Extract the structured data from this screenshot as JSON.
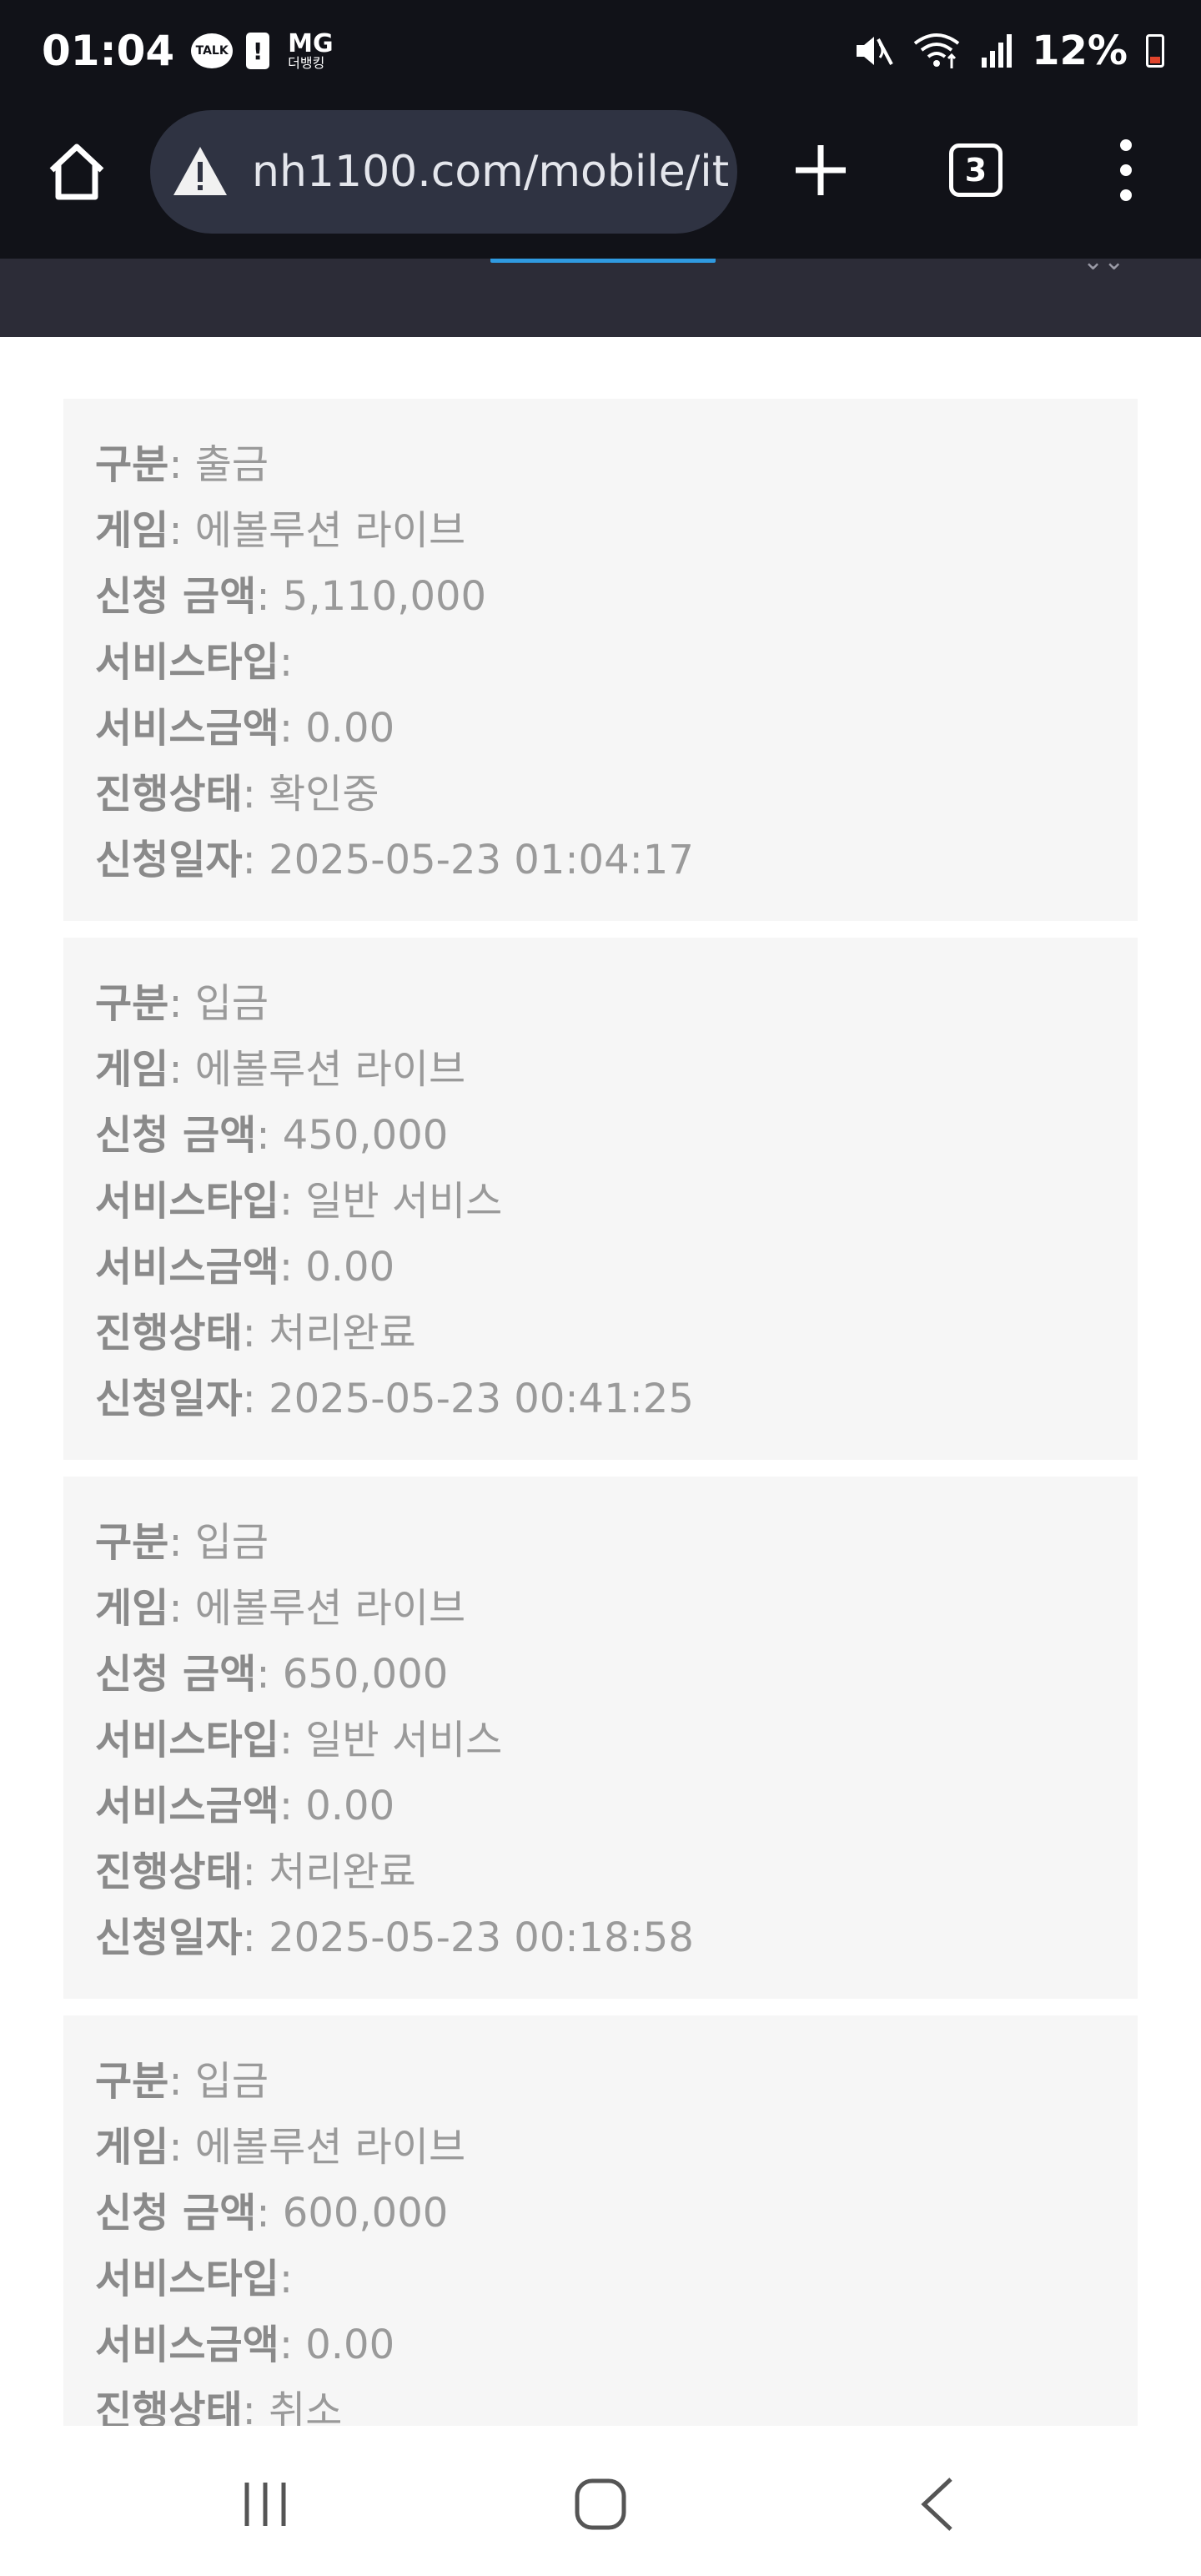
{
  "status_bar": {
    "time": "01:04",
    "talk_badge": "TALK",
    "alert_glyph": "!",
    "mg_label": "MG",
    "mg_sublabel": "더뱅킹",
    "battery_percent": "12%",
    "icons": [
      "kakaotalk-icon",
      "battery-alert-icon",
      "mute-icon",
      "wifi-icon",
      "signal-icon",
      "battery-icon"
    ]
  },
  "browser": {
    "url": "nh1100.com/mobile/it",
    "tab_count": "3",
    "icons": [
      "home-icon",
      "warning-icon",
      "plus-icon",
      "tabs-icon",
      "more-vert-icon"
    ]
  },
  "labels": {
    "category": "구분",
    "game": "게임",
    "amount": "신청 금액",
    "service_type": "서비스타입",
    "service_amount": "서비스금액",
    "status": "진행상태",
    "date": "신청일자"
  },
  "records": [
    {
      "category": "출금",
      "game": "에볼루션 라이브",
      "amount": "5,110,000",
      "service_type": "",
      "service_amount": "0.00",
      "status": "확인중",
      "date": "2025-05-23 01:04:17"
    },
    {
      "category": "입금",
      "game": "에볼루션 라이브",
      "amount": "450,000",
      "service_type": "일반 서비스",
      "service_amount": "0.00",
      "status": "처리완료",
      "date": "2025-05-23 00:41:25"
    },
    {
      "category": "입금",
      "game": "에볼루션 라이브",
      "amount": "650,000",
      "service_type": "일반 서비스",
      "service_amount": "0.00",
      "status": "처리완료",
      "date": "2025-05-23 00:18:58"
    },
    {
      "category": "입금",
      "game": "에볼루션 라이브",
      "amount": "600,000",
      "service_type": "",
      "service_amount": "0.00",
      "status": "취소",
      "date": ""
    }
  ],
  "colors": {
    "bar_bg": "#111218",
    "url_bg": "#2f3342",
    "header_bg": "#2c2c37",
    "card_bg": "#f6f6f6",
    "text": "#9a9a9a",
    "accent": "#2f9ae0"
  }
}
